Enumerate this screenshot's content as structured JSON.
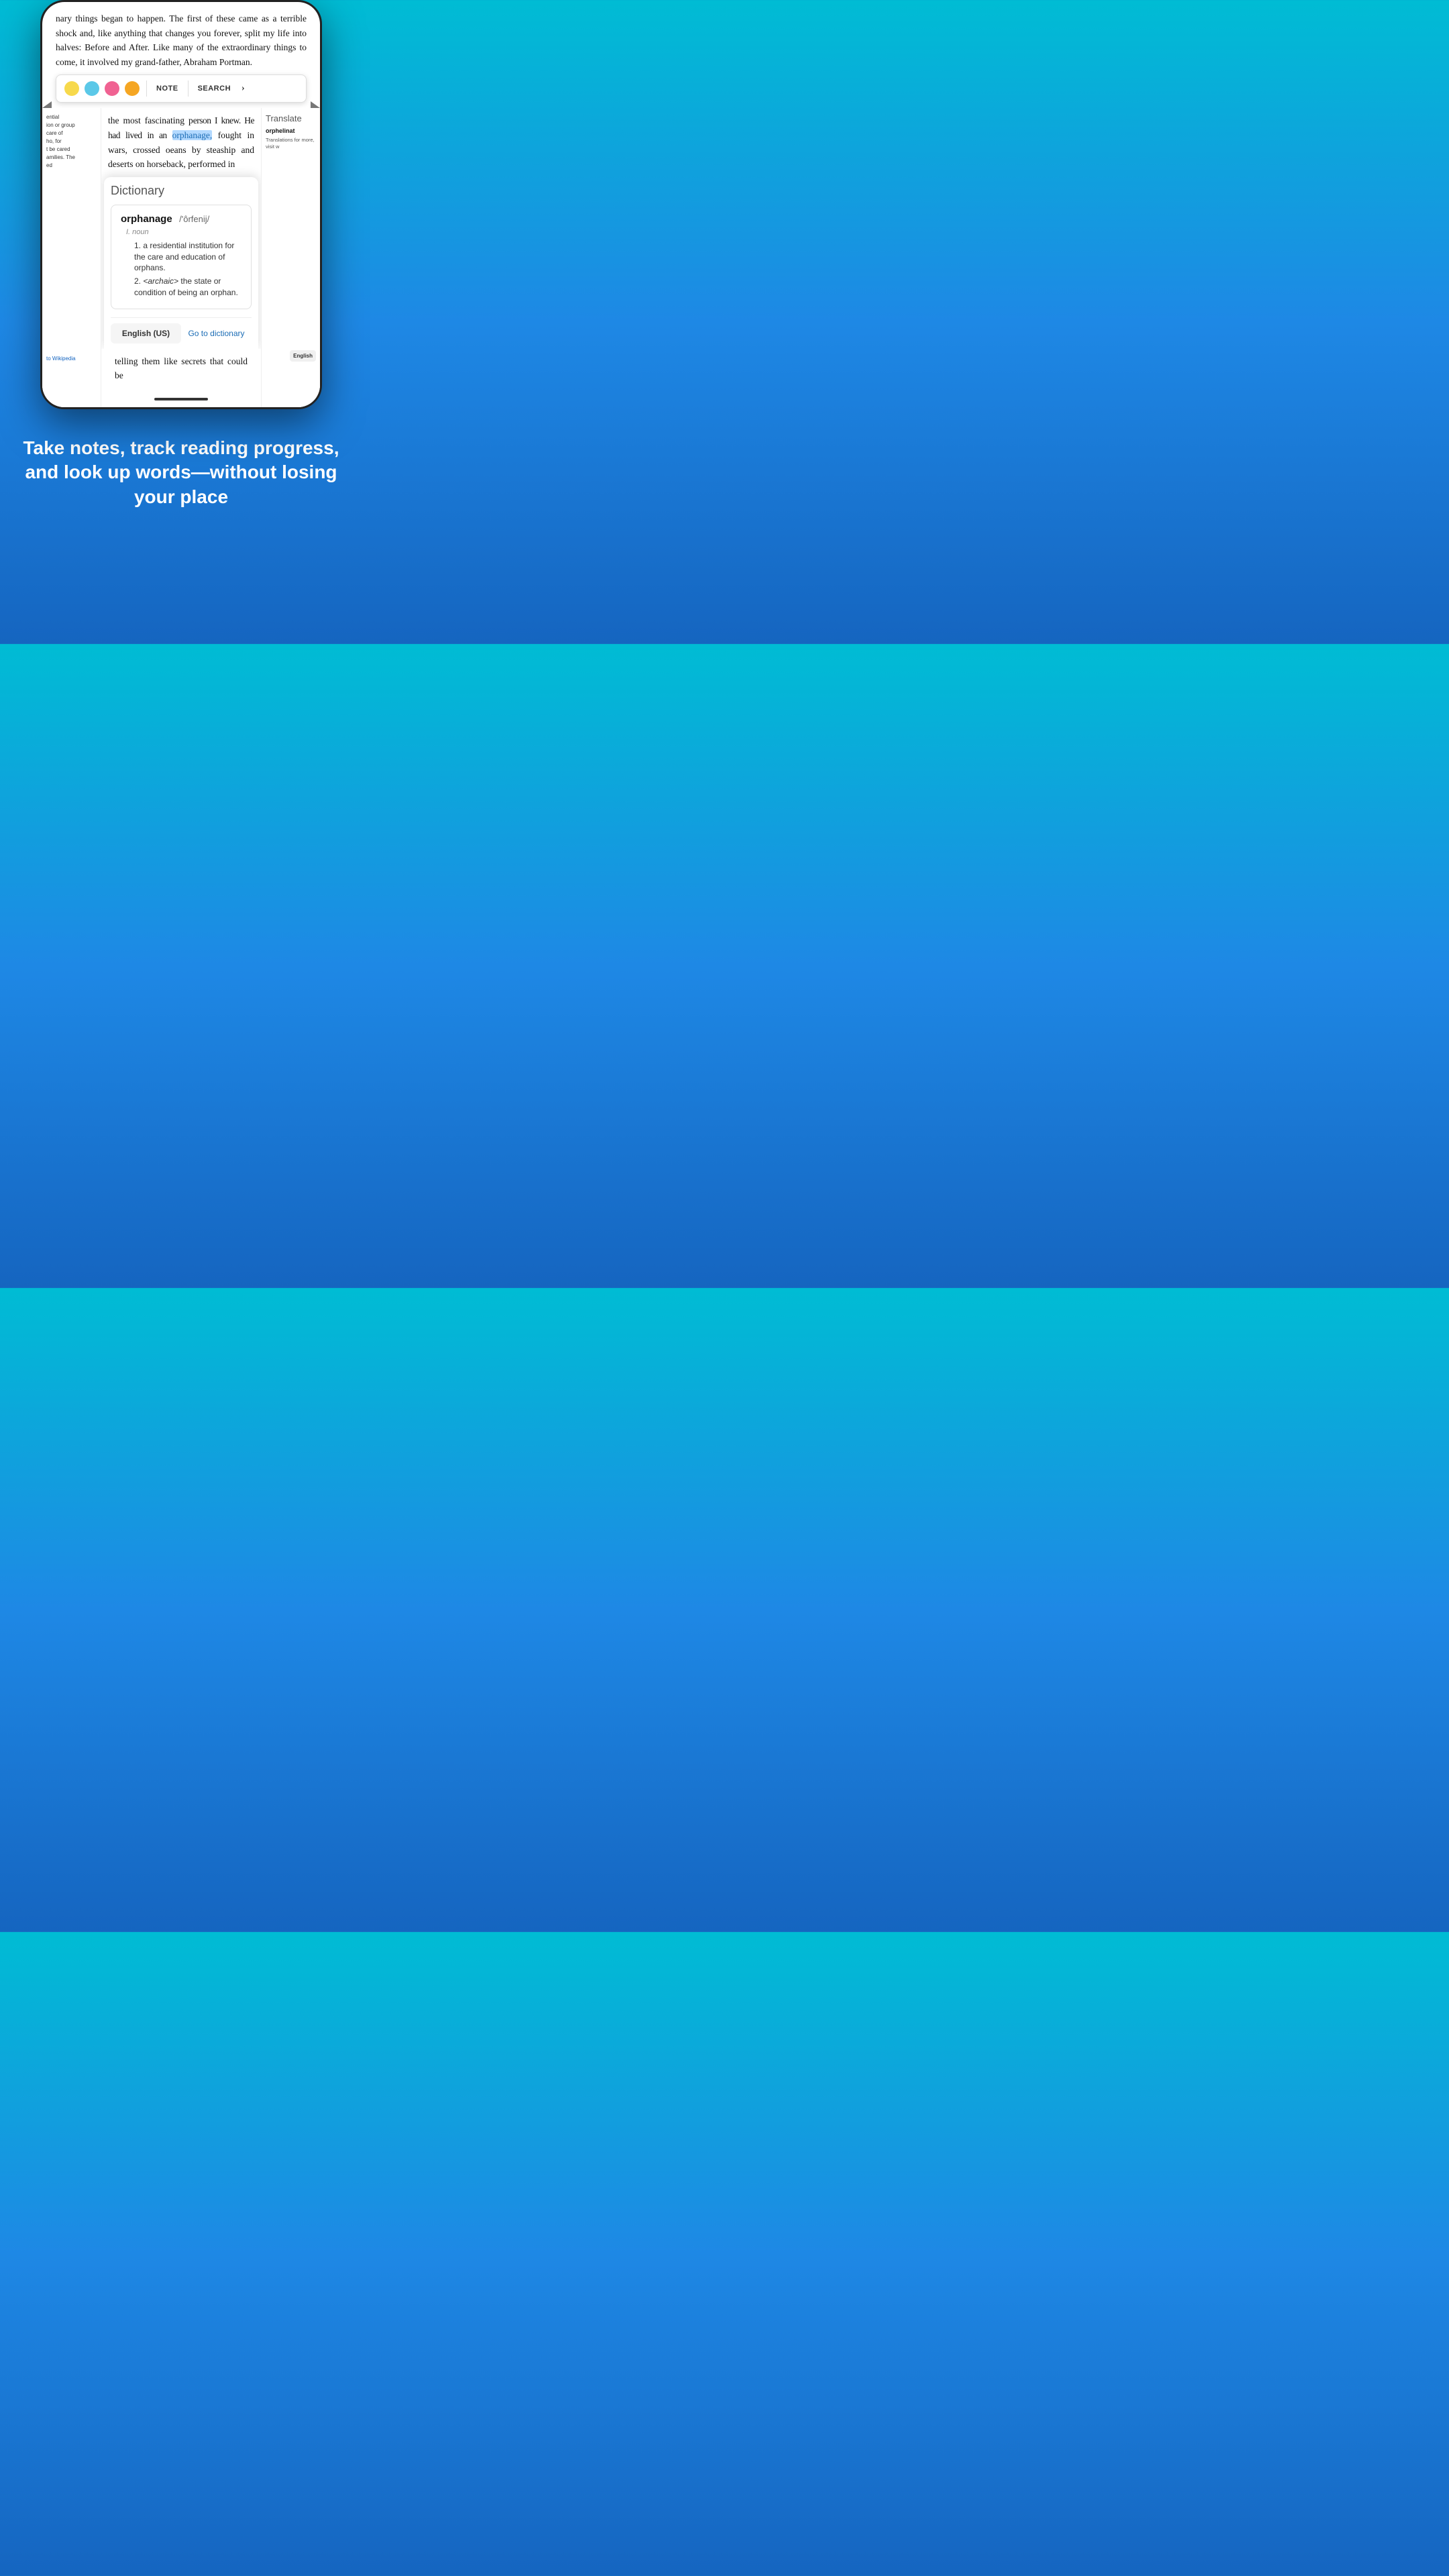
{
  "background": {
    "gradient_start": "#00bcd4",
    "gradient_end": "#1565c0"
  },
  "book": {
    "text_top": "nary things began to happen. The first of these came as a terrible shock and, like anything that changes you forever, split my life into halves: Before and After. Like many of the extraordinary things to come, it involved my grand-father, Abraham Portman.",
    "text_highlighted_prefix": "the most fascinating p",
    "text_highlighted_suffix": "erson I knew. He had lived in an ",
    "highlighted_word": "orphanage,",
    "text_after_highlight": " fought in wars, crossed o",
    "text_after2": "eans by stea",
    "text_after3": "ship and deserts on horseback, performed in",
    "text_bottom": "telling them like secrets that could be"
  },
  "toolbar": {
    "colors": [
      "#f7d94c",
      "#5bc8e8",
      "#f06292",
      "#f5a623"
    ],
    "note_label": "NOTE",
    "search_label": "SEARCH"
  },
  "dictionary": {
    "title": "Dictionary",
    "word": "orphanage",
    "phonetic": "/'ôrfenij/",
    "pos": "noun",
    "pos_label": "I. noun",
    "definitions": [
      {
        "num": "1.",
        "text": "a residential institution for the care and education of orphans."
      },
      {
        "num": "2.",
        "prefix": "<archaic>",
        "text": " the state or condition of being an orphan."
      }
    ],
    "btn_language": "English (US)",
    "btn_goto": "Go to dictionary"
  },
  "wiki_panel": {
    "text_lines": [
      "ential",
      "ion or group",
      "care of",
      "ho, for",
      "t be cared",
      "amilies. The",
      "ed"
    ],
    "link_label": "to Wikipedia"
  },
  "translate_panel": {
    "title": "Translate",
    "word": "orphelinat",
    "description": "Translations for more, visit w",
    "btn_label": "English"
  },
  "tagline": {
    "text": "Take notes, track reading progress, and look up words—without losing your place"
  }
}
